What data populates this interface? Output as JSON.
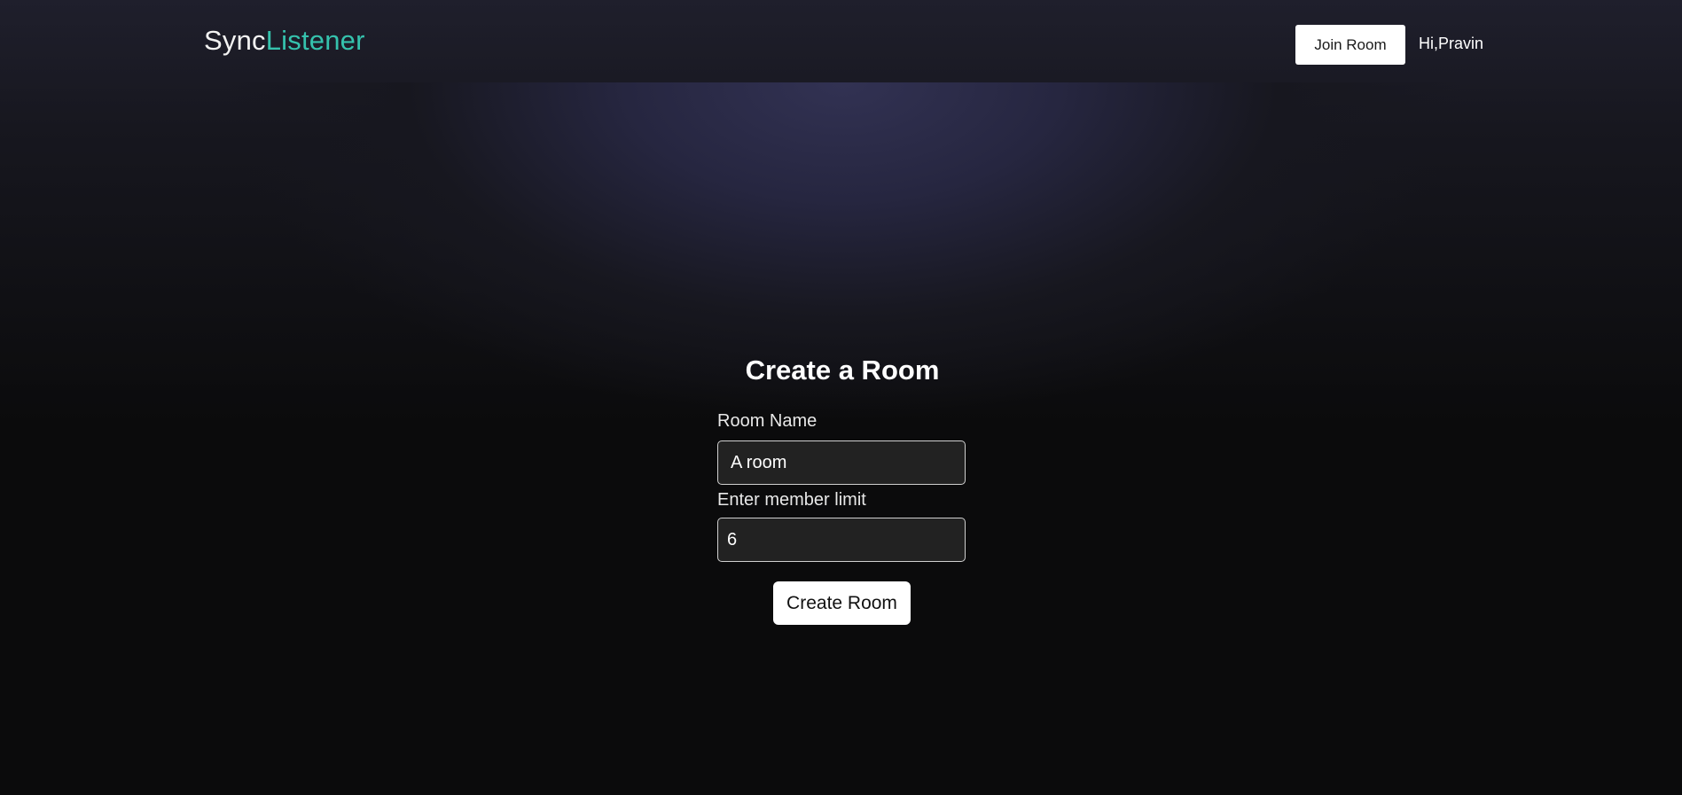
{
  "brand": {
    "part1": "Sync",
    "part2": "Listener",
    "accent_color": "#35c2ad"
  },
  "nav": {
    "join_room_label": "Join Room",
    "greeting": "Hi,Pravin"
  },
  "form": {
    "title": "Create a Room",
    "room_name_label": "Room Name",
    "room_name_value": "A room",
    "member_limit_label": "Enter member limit",
    "member_limit_value": "6",
    "submit_label": "Create Room"
  }
}
